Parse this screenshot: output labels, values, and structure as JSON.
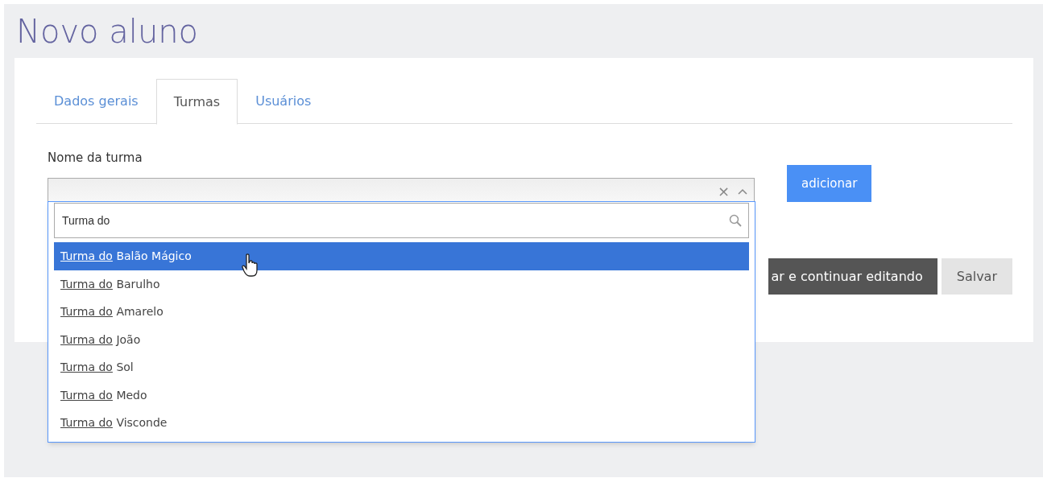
{
  "page_title": "Novo aluno",
  "tabs": [
    {
      "label": "Dados gerais",
      "selected": false
    },
    {
      "label": "Turmas",
      "selected": true
    },
    {
      "label": "Usuários",
      "selected": false
    }
  ],
  "form": {
    "label": "Nome da turma",
    "select": {
      "clear": "×",
      "expanded": true,
      "search": {
        "value": "Turma do"
      },
      "options": [
        {
          "match": "Turma do",
          "rest": "Balão Mágico",
          "selected": true
        },
        {
          "match": "Turma do",
          "rest": "Barulho",
          "selected": false
        },
        {
          "match": "Turma do",
          "rest": "Amarelo",
          "selected": false
        },
        {
          "match": "Turma do",
          "rest": "João",
          "selected": false
        },
        {
          "match": "Turma do",
          "rest": "Sol",
          "selected": false
        },
        {
          "match": "Turma do",
          "rest": "Medo",
          "selected": false
        },
        {
          "match": "Turma do",
          "rest": "Visconde",
          "selected": false
        }
      ]
    },
    "add_button": "adicionar"
  },
  "buttons": [
    {
      "kind": "dark",
      "label": "ar e continuar editando"
    },
    {
      "kind": "light",
      "label": "Salvar"
    }
  ]
}
